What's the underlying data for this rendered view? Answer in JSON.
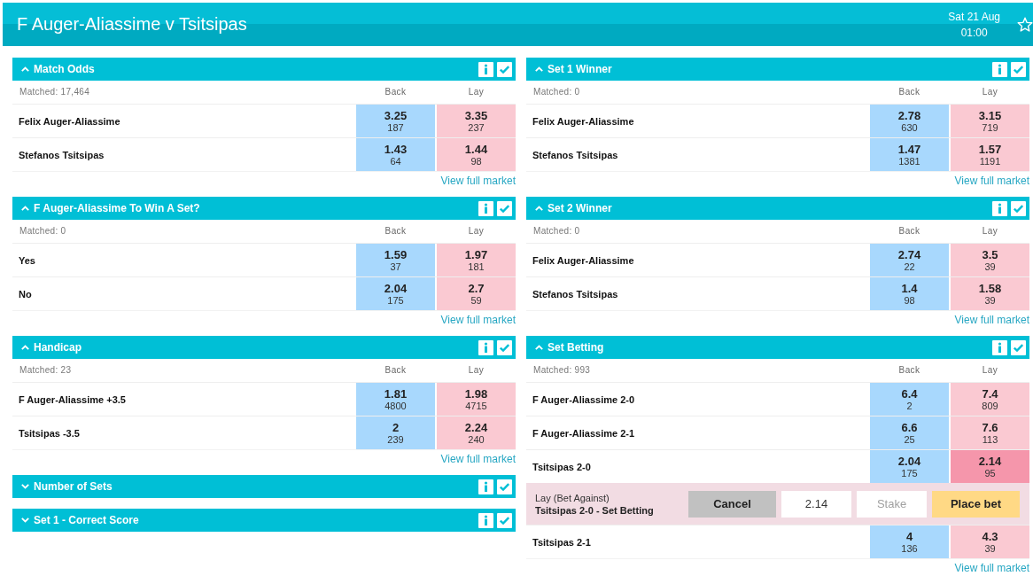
{
  "event": {
    "title": "F Auger-Aliassime v Tsitsipas",
    "date": "Sat 21 Aug",
    "time": "01:00"
  },
  "columns": [
    {
      "markets": [
        {
          "title": "Match Odds",
          "expanded": true,
          "matched": "Matched: 17,464",
          "back_label": "Back",
          "lay_label": "Lay",
          "runners": [
            {
              "name": "Felix Auger-Aliassime",
              "back": {
                "price": "3.25",
                "amount": "187",
                "selected": false
              },
              "lay": {
                "price": "3.35",
                "amount": "237",
                "selected": false
              }
            },
            {
              "name": "Stefanos Tsitsipas",
              "back": {
                "price": "1.43",
                "amount": "64",
                "selected": false
              },
              "lay": {
                "price": "1.44",
                "amount": "98",
                "selected": false
              }
            }
          ],
          "link": "View full market"
        },
        {
          "title": "F Auger-Aliassime To Win A Set?",
          "expanded": true,
          "matched": "Matched: 0",
          "back_label": "Back",
          "lay_label": "Lay",
          "runners": [
            {
              "name": "Yes",
              "back": {
                "price": "1.59",
                "amount": "37",
                "selected": false
              },
              "lay": {
                "price": "1.97",
                "amount": "181",
                "selected": false
              }
            },
            {
              "name": "No",
              "back": {
                "price": "2.04",
                "amount": "175",
                "selected": false
              },
              "lay": {
                "price": "2.7",
                "amount": "59",
                "selected": false
              }
            }
          ],
          "link": "View full market"
        },
        {
          "title": "Handicap",
          "expanded": true,
          "matched": "Matched: 23",
          "back_label": "Back",
          "lay_label": "Lay",
          "runners": [
            {
              "name": "F Auger-Aliassime +3.5",
              "back": {
                "price": "1.81",
                "amount": "4800",
                "selected": false
              },
              "lay": {
                "price": "1.98",
                "amount": "4715",
                "selected": false
              }
            },
            {
              "name": "Tsitsipas -3.5",
              "back": {
                "price": "2",
                "amount": "239",
                "selected": false
              },
              "lay": {
                "price": "2.24",
                "amount": "240",
                "selected": false
              }
            }
          ],
          "link": "View full market"
        },
        {
          "title": "Number of Sets",
          "expanded": false
        },
        {
          "title": "Set 1 - Correct Score",
          "expanded": false
        }
      ]
    },
    {
      "markets": [
        {
          "title": "Set 1 Winner",
          "expanded": true,
          "matched": "Matched: 0",
          "back_label": "Back",
          "lay_label": "Lay",
          "runners": [
            {
              "name": "Felix Auger-Aliassime",
              "back": {
                "price": "2.78",
                "amount": "630",
                "selected": false
              },
              "lay": {
                "price": "3.15",
                "amount": "719",
                "selected": false
              }
            },
            {
              "name": "Stefanos Tsitsipas",
              "back": {
                "price": "1.47",
                "amount": "1381",
                "selected": false
              },
              "lay": {
                "price": "1.57",
                "amount": "1191",
                "selected": false
              }
            }
          ],
          "link": "View full market"
        },
        {
          "title": "Set 2 Winner",
          "expanded": true,
          "matched": "Matched: 0",
          "back_label": "Back",
          "lay_label": "Lay",
          "runners": [
            {
              "name": "Felix Auger-Aliassime",
              "back": {
                "price": "2.74",
                "amount": "22",
                "selected": false
              },
              "lay": {
                "price": "3.5",
                "amount": "39",
                "selected": false
              }
            },
            {
              "name": "Stefanos Tsitsipas",
              "back": {
                "price": "1.4",
                "amount": "98",
                "selected": false
              },
              "lay": {
                "price": "1.58",
                "amount": "39",
                "selected": false
              }
            }
          ],
          "link": "View full market"
        },
        {
          "title": "Set Betting",
          "expanded": true,
          "matched": "Matched: 993",
          "back_label": "Back",
          "lay_label": "Lay",
          "runners": [
            {
              "name": "F Auger-Aliassime 2-0",
              "back": {
                "price": "6.4",
                "amount": "2",
                "selected": false
              },
              "lay": {
                "price": "7.4",
                "amount": "809",
                "selected": false
              }
            },
            {
              "name": "F Auger-Aliassime 2-1",
              "back": {
                "price": "6.6",
                "amount": "25",
                "selected": false
              },
              "lay": {
                "price": "7.6",
                "amount": "113",
                "selected": false
              }
            },
            {
              "name": "Tsitsipas 2-0",
              "back": {
                "price": "2.04",
                "amount": "175",
                "selected": false
              },
              "lay": {
                "price": "2.14",
                "amount": "95",
                "selected": true
              }
            },
            {
              "name": "Tsitsipas 2-1",
              "back": {
                "price": "4",
                "amount": "136",
                "selected": false
              },
              "lay": {
                "price": "4.3",
                "amount": "39",
                "selected": false
              }
            }
          ],
          "bet_slip": {
            "bet_type": "Lay (Bet Against)",
            "selection": "Tsitsipas 2-0 - Set Betting",
            "cancel_label": "Cancel",
            "odds_value": "2.14",
            "stake_placeholder": "Stake",
            "place_label": "Place bet"
          },
          "link": "View full market"
        }
      ]
    }
  ]
}
